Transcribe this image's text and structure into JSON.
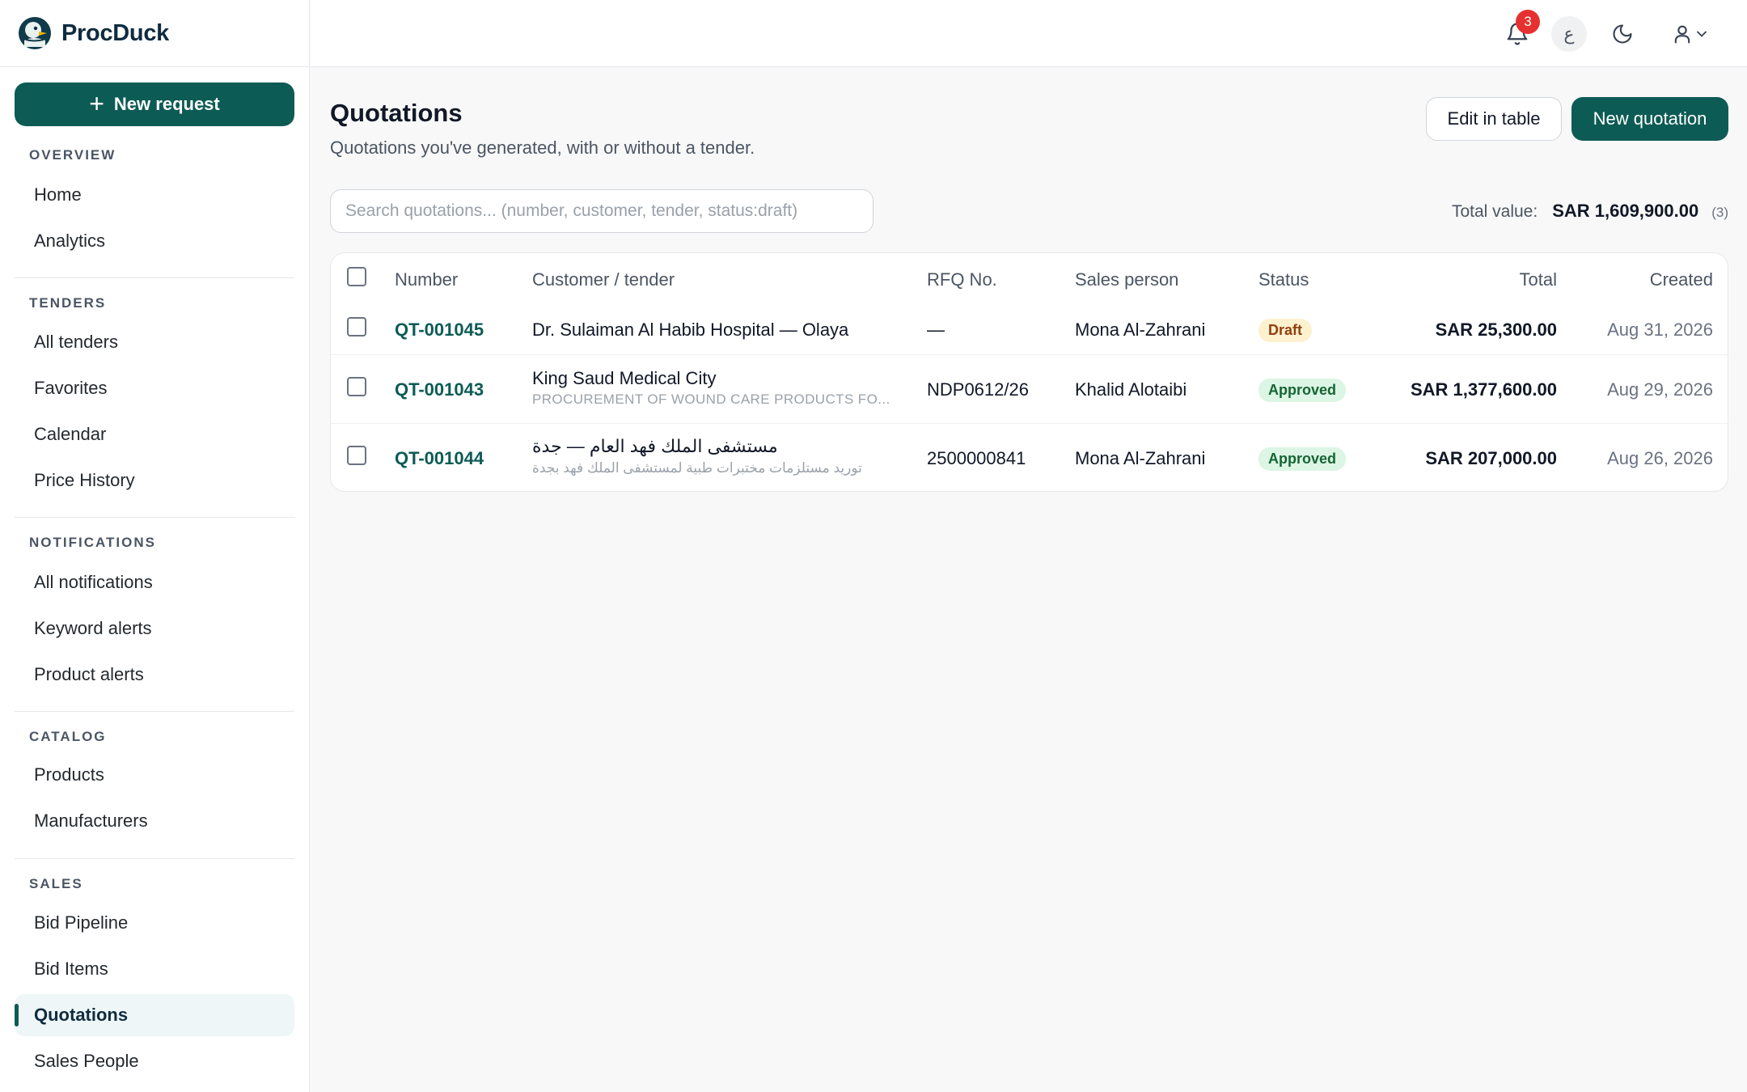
{
  "app": {
    "name": "ProcDuck"
  },
  "sidebar": {
    "new_request_label": "New request",
    "sections": [
      {
        "title": "OVERVIEW",
        "items": [
          "Home",
          "Analytics"
        ]
      },
      {
        "title": "TENDERS",
        "items": [
          "All tenders",
          "Favorites",
          "Calendar",
          "Price History"
        ]
      },
      {
        "title": "NOTIFICATIONS",
        "items": [
          "All notifications",
          "Keyword alerts",
          "Product alerts"
        ]
      },
      {
        "title": "CATALOG",
        "items": [
          "Products",
          "Manufacturers"
        ]
      },
      {
        "title": "SALES",
        "items": [
          "Bid Pipeline",
          "Bid Items",
          "Quotations",
          "Sales People"
        ]
      }
    ],
    "active_item": "Quotations"
  },
  "topbar": {
    "notification_count": "3",
    "language_toggle": "ع",
    "icons": [
      "bell-icon",
      "language-icon",
      "moon-icon",
      "user-icon",
      "chevron-down-icon"
    ]
  },
  "page": {
    "title": "Quotations",
    "subtitle": "Quotations you've generated, with or without a tender.",
    "edit_button": "Edit in table",
    "new_button": "New quotation",
    "search_placeholder": "Search quotations... (number, customer, tender, status:draft)",
    "total_label": "Total value:",
    "total_value": "SAR 1,609,900.00",
    "total_count": "(3)"
  },
  "table": {
    "headers": {
      "number": "Number",
      "customer": "Customer / tender",
      "rfq": "RFQ No.",
      "sales": "Sales person",
      "status": "Status",
      "total": "Total",
      "created": "Created"
    },
    "rows": [
      {
        "number": "QT-001045",
        "customer": "Dr. Sulaiman Al Habib Hospital — Olaya",
        "tender": "",
        "rfq": "—",
        "sales": "Mona Al-Zahrani",
        "status": "Draft",
        "total": "SAR 25,300.00",
        "created": "Aug 31, 2026"
      },
      {
        "number": "QT-001043",
        "customer": "King Saud Medical City",
        "tender": "PROCUREMENT OF WOUND CARE PRODUCTS FO...",
        "rfq": "NDP0612/26",
        "sales": "Khalid Alotaibi",
        "status": "Approved",
        "total": "SAR 1,377,600.00",
        "created": "Aug 29, 2026"
      },
      {
        "number": "QT-001044",
        "customer": "مستشفى الملك فهد العام — جدة",
        "tender": "توريد مستلزمات مختبرات طبية لمستشفى الملك فهد بجدة",
        "rfq": "2500000841",
        "sales": "Mona Al-Zahrani",
        "status": "Approved",
        "total": "SAR 207,000.00",
        "created": "Aug 26, 2026"
      }
    ]
  },
  "colors": {
    "brand": "#0d5b55",
    "badge_red": "#e5312f",
    "draft_bg": "#fdf1cf",
    "approved_bg": "#dcf5e4"
  }
}
